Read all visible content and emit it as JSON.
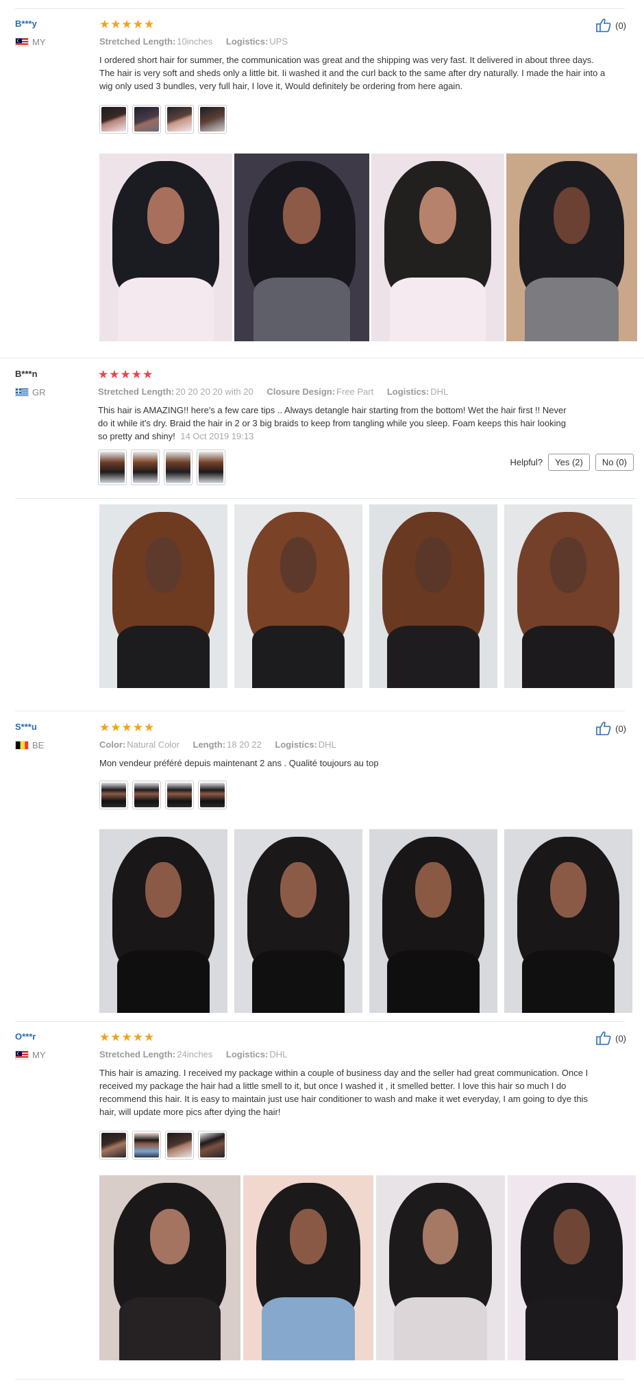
{
  "reviews": [
    {
      "user": "B***y",
      "country": "MY",
      "stars": 5,
      "meta": [
        {
          "k": "Stretched Length:",
          "v": "10inches"
        },
        {
          "k": "Logistics:",
          "v": "UPS"
        }
      ],
      "text": "I ordered short hair for summer, the communication was great and the shipping was very fast. It delivered in about three days. The hair is very soft and sheds only a little bit. Ii washed it and the curl back to the same after dry naturally. I made the hair into a wig only used 3 bundles, very full hair, I love it, Would definitely be ordering from here again.",
      "likes": "(0)"
    },
    {
      "user": "B***n",
      "country": "GR",
      "stars": 5,
      "meta": [
        {
          "k": "Stretched Length:",
          "v": "20 20 20 20 with 20"
        },
        {
          "k": "Closure Design:",
          "v": "Free Part"
        },
        {
          "k": "Logistics:",
          "v": "DHL"
        }
      ],
      "text": "This hair is AMAZING!! here's a few care tips .. Always detangle hair starting from the bottom! Wet the hair first !! Never do it while it's dry. Braid the hair in 2 or 3 big braids to keep from tangling while you sleep. Foam keeps this hair looking so pretty and shiny!",
      "date": "14 Oct 2019 19:13",
      "helpful_label": "Helpful?",
      "yes_label": "Yes (2)",
      "no_label": "No (0)"
    },
    {
      "user": "S***u",
      "country": "BE",
      "stars": 5,
      "meta": [
        {
          "k": "Color:",
          "v": "Natural Color"
        },
        {
          "k": "Length:",
          "v": "18 20 22"
        },
        {
          "k": "Logistics:",
          "v": "DHL"
        }
      ],
      "text": "Mon vendeur préféré depuis maintenant 2 ans . Qualité toujours au top",
      "likes": "(0)"
    },
    {
      "user": "O***r",
      "country": "MY",
      "stars": 5,
      "meta": [
        {
          "k": "Stretched Length:",
          "v": "24inches"
        },
        {
          "k": "Logistics:",
          "v": "DHL"
        }
      ],
      "text": "This hair is amazing. I received my package within a couple of business day and the seller had great communication. Once I received my package the hair had a little smell to it, but once I washed it , it smelled better. I love this hair so much I do recommend this hair. It is easy to maintain just use hair conditioner to wash and make it wet everyday, I am going to dye this hair, will update more pics after dying the hair!",
      "likes": "(0)"
    }
  ],
  "colors": {
    "username": "#2a6bb5",
    "star_gold": "#f3a21c",
    "star_red": "#e8454d",
    "muted": "#aaaaaa"
  },
  "icons": {
    "thumbs_up": "thumbs-up-icon",
    "star": "star-icon",
    "flag": "flag-icon"
  }
}
